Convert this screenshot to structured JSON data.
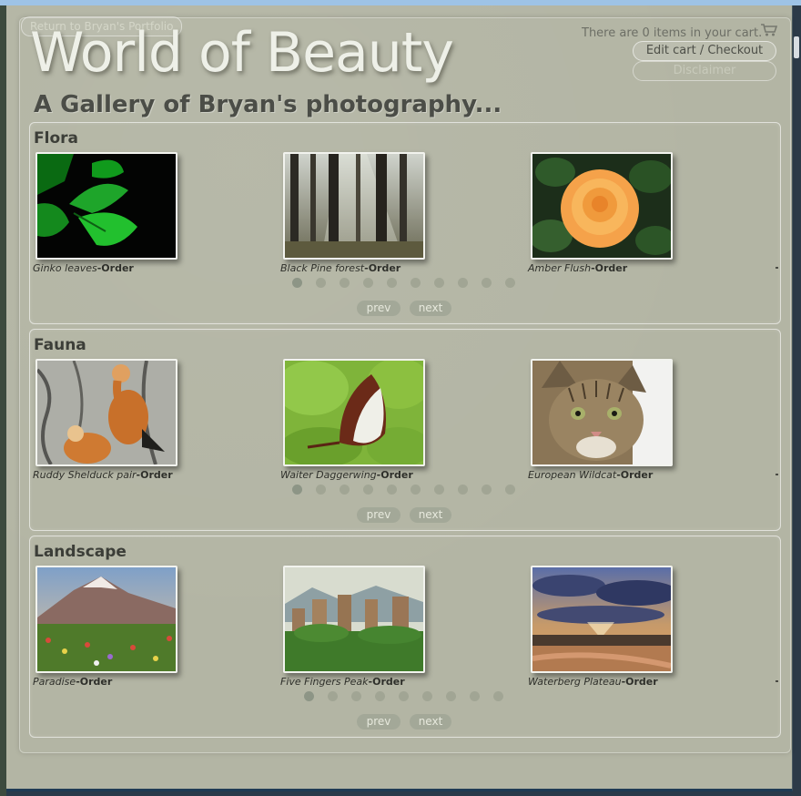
{
  "header": {
    "return_link": "Return to Bryan's Portfolio",
    "title": "World of Beauty",
    "subtitle": "A Gallery of Bryan's photography...",
    "cart_text": "There are 0 items in your cart.",
    "edit_cart": "Edit cart / Checkout",
    "disclaimer": "Disclaimer"
  },
  "galleries": [
    {
      "heading": "Flora",
      "items": [
        {
          "title": "Ginko leaves",
          "order": "-Order"
        },
        {
          "title": "Black Pine forest",
          "order": "-Order"
        },
        {
          "title": "Amber Flush",
          "order": "-Order"
        }
      ],
      "prev": "prev",
      "next": "next"
    },
    {
      "heading": "Fauna",
      "items": [
        {
          "title": "Ruddy Shelduck pair",
          "order": "-Order"
        },
        {
          "title": "Waiter Daggerwing",
          "order": "-Order"
        },
        {
          "title": "European Wildcat",
          "order": "-Order"
        }
      ],
      "prev": "prev",
      "next": "next"
    },
    {
      "heading": "Landscape",
      "items": [
        {
          "title": "Paradise",
          "order": "-Order"
        },
        {
          "title": "Five Fingers Peak",
          "order": "-Order"
        },
        {
          "title": "Waterberg Plateau",
          "order": "-Order"
        }
      ],
      "prev": "prev",
      "next": "next"
    }
  ],
  "icons": {
    "cart": "shopping-cart-icon"
  },
  "colors": {
    "page_background": "#b3b5a4",
    "title_text": "#eef0e8",
    "heading_text": "#3c3e38",
    "pager_dot": "#a1a594",
    "nav_button": "#a3a898"
  }
}
